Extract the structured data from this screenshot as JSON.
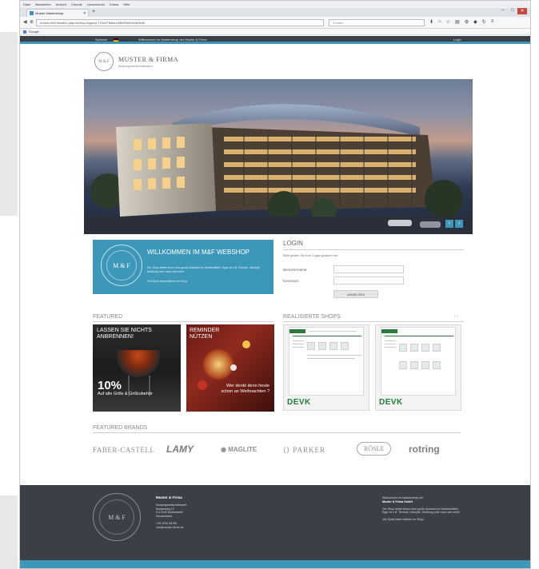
{
  "browser": {
    "menu": [
      "Datei",
      "Bearbeiten",
      "Ansicht",
      "Chronik",
      "Lesezeichen",
      "Extras",
      "Hilfe"
    ],
    "tab_title": "Muster Markenshop",
    "new_tab_glyph": "+",
    "url": "muster.dell.nt/index.php/de/shop/login/id.123/ef78dbecd9bf0f4b5d1fa9b3b",
    "search_placeholder": "Suchen",
    "bookmark": "Google",
    "min_glyph": "–",
    "max_glyph": "□",
    "close_glyph": "✕"
  },
  "site": {
    "topbar": {
      "language": "Sprache",
      "welcome": "Willkommen im Markenshop der Muster & Firma",
      "login": "Login"
    },
    "logo": {
      "title": "MUSTER & FIRMA",
      "subtitle": "Mustergesellschaftswert",
      "mark": "M & F"
    },
    "hero_prev": "‹",
    "hero_next": "›",
    "welcome": {
      "heading": "WILLKOMMEN IM M&F WEBSHOP",
      "text1": "Der Shop bietet Ihnen eine große Auswahl an Werbemitteln. Egal ob z.B. Technik, Lifestyle, Kleidung oder noch viel mehr!",
      "text2": "Viel Spaß beim stöbern im Shop.",
      "mark": "M & F"
    },
    "login": {
      "heading": "LOGIN",
      "hint": "Bitte geben Sie Ihre Zugangsdaten ein",
      "username_label": "Benutzername:",
      "password_label": "Kennwort:",
      "button": "ANMELDEN"
    },
    "featured": {
      "heading": "FEATURED",
      "tile1_title": "LASSEN SIE NICHTS ANBRENNEN!",
      "tile1_pct": "10%",
      "tile1_sub": "Auf alle Grills & Grillzubehör",
      "tile2_title": "REMINDER NÜTZEN",
      "tile2_text": "Wer denkt denn heute schon an Weihnachten ?"
    },
    "shops": {
      "heading": "REALISIERTE SHOPS",
      "arrows": "‹ ›",
      "brand": "DEVK"
    },
    "brands": {
      "heading": "FEATURED BRANDS",
      "items": [
        "FABER-CASTELL",
        "LAMY",
        "MAGLITE",
        "PARKER",
        "RÖSLE",
        "rotring"
      ],
      "parker_glyph": "⟨⟩",
      "maglite_glyph": "◉"
    },
    "footer": {
      "company_title": "Muster & Firma",
      "address": [
        "Mustergesellschaftswert",
        "Musterweg 12",
        "D-12345 Musterstadt",
        "Deutschland"
      ],
      "phone": "+49 1234 56789",
      "email": "info@muster-firma.de",
      "right_title_1": "Willkommen im Markenshop der",
      "right_title_2": "Muster & Firma GmbH",
      "right_text": "Der Shop bietet Ihnen eine große Auswahl an Werbemitteln. Egal ob z.B. Technik, Lifestyle, Kleidung oder noch viel mehr!",
      "right_text2": "Viel Spaß beim stöbern im Shop.",
      "mark": "M & F"
    },
    "colors": {
      "accent": "#3c97b8",
      "dark": "#3b4046",
      "devk_green": "#1f7c3b"
    }
  }
}
